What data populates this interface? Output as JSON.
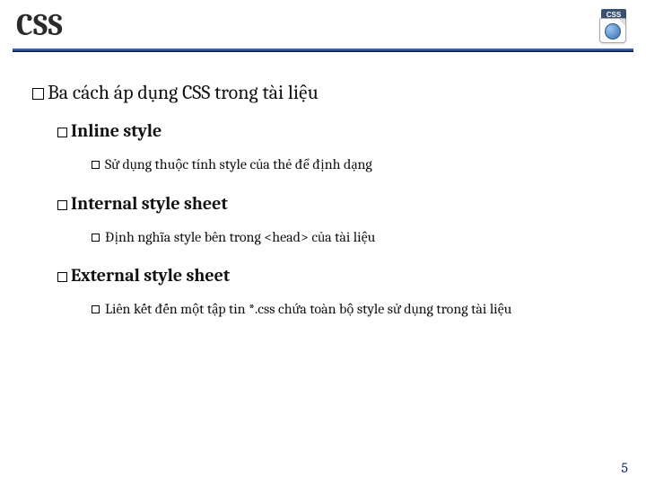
{
  "header": {
    "title": "CSS",
    "logo_tag": "CSS"
  },
  "content": {
    "heading": "Ba cách áp dụng CSS trong tài liệu",
    "items": [
      {
        "title": "Inline style",
        "desc": "Sử dụng thuộc tính style của thẻ để định dạng"
      },
      {
        "title": "Internal style sheet",
        "desc": "Định nghĩa style bên trong <head> của tài liệu"
      },
      {
        "title": "External style sheet",
        "desc": "Liên kết đến một tập tin *.css chứa toàn bộ style sử dụng trong tài liệu"
      }
    ]
  },
  "page_number": "5"
}
